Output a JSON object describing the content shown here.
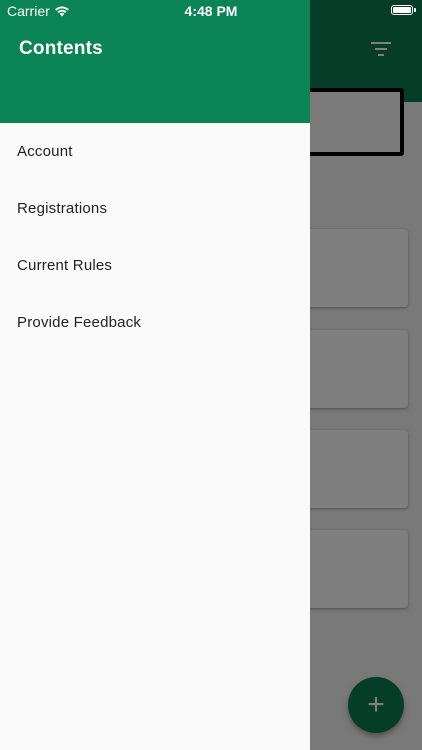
{
  "status_bar": {
    "carrier": "Carrier",
    "time": "4:48 PM"
  },
  "drawer": {
    "title": "Contents",
    "items": [
      {
        "label": "Account"
      },
      {
        "label": "Registrations"
      },
      {
        "label": "Current Rules"
      },
      {
        "label": "Provide Feedback"
      }
    ]
  },
  "background": {
    "fab_label": "+",
    "icons": {
      "filter": "filter-icon",
      "add": "add-icon",
      "wifi": "wifi-icon",
      "battery": "battery-icon"
    }
  },
  "colors": {
    "drawer_header": "#0a8457",
    "app_bar": "#0c7a52",
    "drawer_background": "#fafafa",
    "fab": "#0c7a52"
  }
}
